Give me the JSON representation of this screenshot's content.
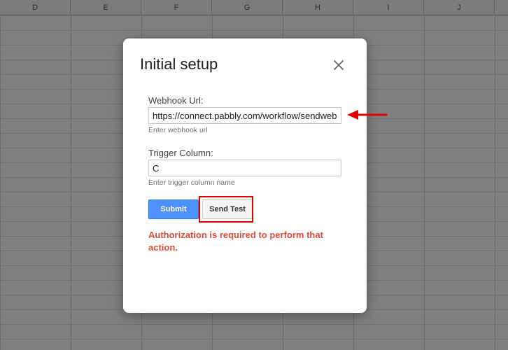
{
  "sheet": {
    "columns": [
      "D",
      "E",
      "F",
      "G",
      "H",
      "I",
      "J"
    ]
  },
  "dialog": {
    "title": "Initial setup",
    "webhook": {
      "label": "Webhook Url:",
      "value": "https://connect.pabbly.com/workflow/sendwebl",
      "hint": "Enter webhook url"
    },
    "trigger": {
      "label": "Trigger Column:",
      "value": "C",
      "hint": "Enter trigger column name"
    },
    "submit_label": "Submit",
    "send_test_label": "Send Test",
    "error_message": "Authorization is required to perform that action."
  },
  "colors": {
    "submit": "#4d90fe",
    "error": "#dd4b39",
    "annotation": "#e00000"
  },
  "icons": {
    "close": "close-icon",
    "annotation_arrow": "arrow-left-icon"
  }
}
